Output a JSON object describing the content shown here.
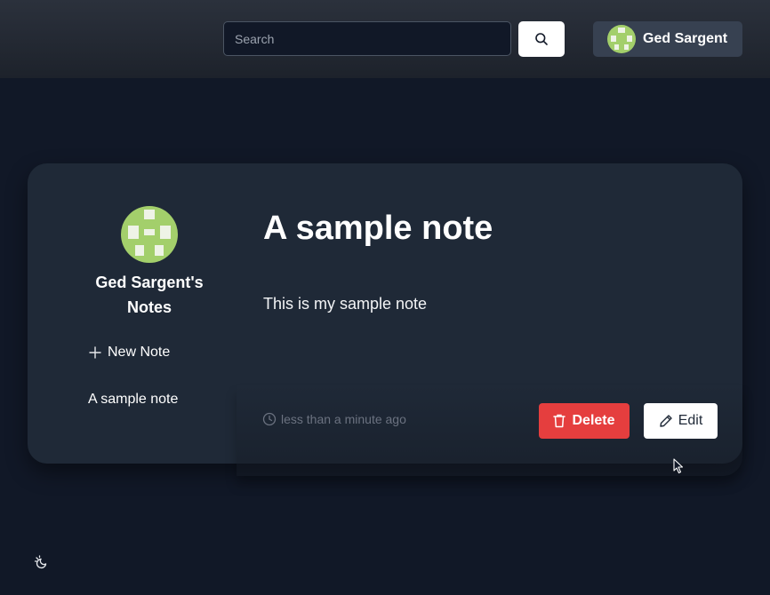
{
  "header": {
    "search": {
      "placeholder": "Search",
      "value": ""
    },
    "search_button_icon": "search-icon",
    "user": {
      "name": "Ged Sargent",
      "avatar_icon": "identicon-avatar"
    }
  },
  "sidebar": {
    "owner_title": "Ged Sargent's Notes",
    "new_note_label": "New Note",
    "new_note_icon": "plus-icon",
    "notes": [
      {
        "title": "A sample note"
      }
    ]
  },
  "note": {
    "title": "A sample note",
    "body": "This is my sample note",
    "updated": "less than a minute ago",
    "updated_icon": "clock-icon"
  },
  "actions": {
    "delete_label": "Delete",
    "delete_icon": "trash-icon",
    "edit_label": "Edit",
    "edit_icon": "pencil-icon"
  },
  "theme_toggle_icon": "moon-sun-icon",
  "colors": {
    "background": "#111827",
    "header": "#242a34",
    "card": "#1f2937",
    "user_button": "#374151",
    "delete": "#e53e3e",
    "avatar_green": "#a3cf6b",
    "muted_text": "#6b7280"
  }
}
